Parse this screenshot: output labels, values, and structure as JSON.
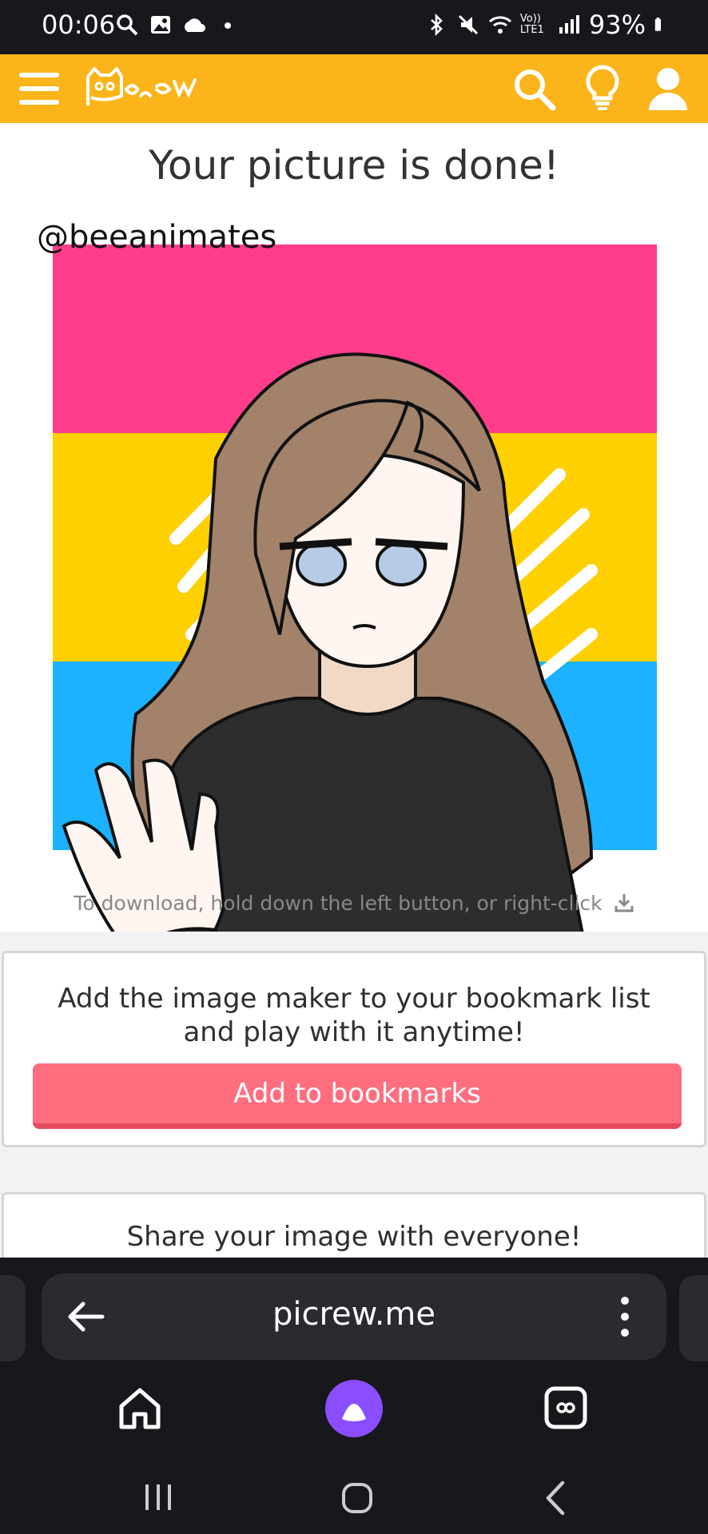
{
  "status_bar": {
    "time": "00:06",
    "battery": "93%",
    "network": "Vo)) LTE1"
  },
  "app_bar": {
    "logo_text": "Picrew",
    "brand_color": "#fbb51a"
  },
  "page": {
    "title": "Your picture is done!",
    "artwork_signature": "@beeanimates",
    "download_hint": "To download, hold down the left button, or right-click"
  },
  "bookmark_card": {
    "text": "Add the image maker to your bookmark list and play with it anytime!",
    "button_label": "Add to bookmarks",
    "button_color": "#ff6e7f"
  },
  "share_card": {
    "text": "Share your image with everyone!"
  },
  "browser": {
    "url": "picrew.me"
  },
  "icons": {
    "app_bar": [
      "menu-icon",
      "search-icon",
      "lightbulb-icon",
      "user-icon"
    ],
    "browser_nav": [
      "back-arrow-icon",
      "more-vertical-icon",
      "home-icon",
      "assistant-icon",
      "tabs-icon"
    ],
    "system_nav": [
      "recent-apps-icon",
      "system-home-icon",
      "system-back-icon"
    ]
  }
}
